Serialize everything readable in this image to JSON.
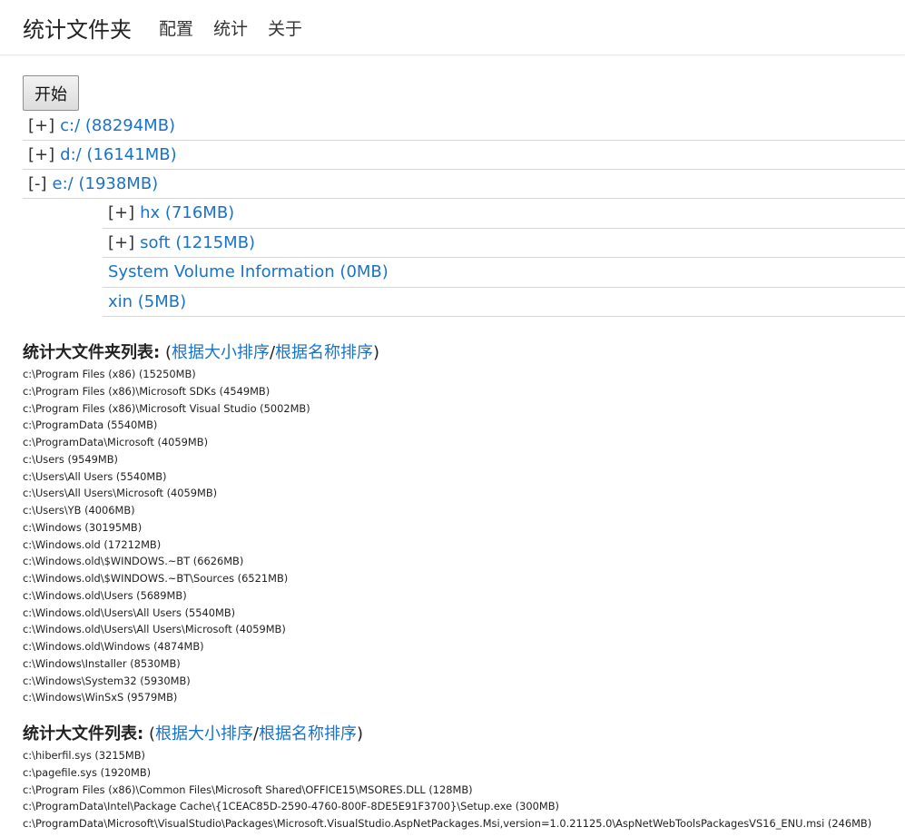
{
  "navbar": {
    "brand": "统计文件夹",
    "links": [
      "配置",
      "统计",
      "关于"
    ]
  },
  "start_button": "开始",
  "tree": {
    "drives": [
      {
        "toggle": "[+]",
        "label": "c:/ (88294MB)"
      },
      {
        "toggle": "[+]",
        "label": "d:/ (16141MB)"
      },
      {
        "toggle": "[-]",
        "label": "e:/ (1938MB)"
      }
    ],
    "e_children": [
      {
        "toggle": "[+]",
        "label": "hx (716MB)"
      },
      {
        "toggle": "[+]",
        "label": "soft (1215MB)"
      },
      {
        "toggle": "",
        "label": "System Volume Information (0MB)"
      },
      {
        "toggle": "",
        "label": "xin (5MB)"
      }
    ]
  },
  "folders_section": {
    "title": "统计大文件夹列表:",
    "open_paren": "(",
    "sort_by_size": "根据大小排序",
    "slash": "/",
    "sort_by_name": "根据名称排序",
    "close_paren": ")",
    "items": [
      "c:\\Program Files (x86) (15250MB)",
      "c:\\Program Files (x86)\\Microsoft SDKs (4549MB)",
      "c:\\Program Files (x86)\\Microsoft Visual Studio (5002MB)",
      "c:\\ProgramData (5540MB)",
      "c:\\ProgramData\\Microsoft (4059MB)",
      "c:\\Users (9549MB)",
      "c:\\Users\\All Users (5540MB)",
      "c:\\Users\\All Users\\Microsoft (4059MB)",
      "c:\\Users\\YB (4006MB)",
      "c:\\Windows (30195MB)",
      "c:\\Windows.old (17212MB)",
      "c:\\Windows.old\\$WINDOWS.~BT (6626MB)",
      "c:\\Windows.old\\$WINDOWS.~BT\\Sources (6521MB)",
      "c:\\Windows.old\\Users (5689MB)",
      "c:\\Windows.old\\Users\\All Users (5540MB)",
      "c:\\Windows.old\\Users\\All Users\\Microsoft (4059MB)",
      "c:\\Windows.old\\Windows (4874MB)",
      "c:\\Windows\\Installer (8530MB)",
      "c:\\Windows\\System32 (5930MB)",
      "c:\\Windows\\WinSxS (9579MB)"
    ]
  },
  "files_section": {
    "title": "统计大文件列表:",
    "open_paren": "(",
    "sort_by_size": "根据大小排序",
    "slash": "/",
    "sort_by_name": "根据名称排序",
    "close_paren": ")",
    "items": [
      "c:\\hiberfil.sys (3215MB)",
      "c:\\pagefile.sys (1920MB)",
      "c:\\Program Files (x86)\\Common Files\\Microsoft Shared\\OFFICE15\\MSORES.DLL (128MB)",
      "c:\\ProgramData\\Intel\\Package Cache\\{1CEAC85D-2590-4760-800F-8DE5E91F3700}\\Setup.exe (300MB)",
      "c:\\ProgramData\\Microsoft\\VisualStudio\\Packages\\Microsoft.VisualStudio.AspNetPackages.Msi,version=1.0.21125.0\\AspNetWebToolsPackagesVS16_ENU.msi (246MB)"
    ]
  }
}
